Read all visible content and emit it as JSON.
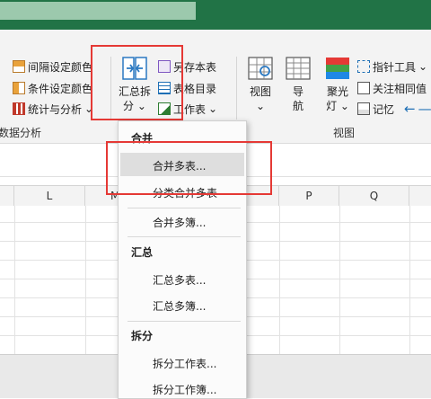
{
  "titlebar": {
    "color": "#217346"
  },
  "ribbon": {
    "left_items": [
      {
        "label": "间隔设定颜色",
        "icon": "interval-color-icon"
      },
      {
        "label": "条件设定颜色",
        "icon": "condition-color-icon"
      },
      {
        "label": "统计与分析",
        "icon": "statistics-icon",
        "arrow": "⌄"
      }
    ],
    "left_group_label": "数据分析",
    "merge_split": {
      "line1": "汇总拆",
      "line2": "分",
      "arrow": "⌄"
    },
    "mid_items": [
      {
        "label": "另存本表",
        "icon": "save-sheet-icon"
      },
      {
        "label": "表格目录",
        "icon": "sheet-catalog-icon"
      },
      {
        "label": "工作表",
        "icon": "worksheet-icon",
        "arrow": "⌄"
      }
    ],
    "view_buttons": [
      {
        "line1": "视图",
        "line2": "⌄"
      },
      {
        "line1": "导",
        "line2": "航"
      },
      {
        "line1": "聚光",
        "line2": "灯 ⌄"
      }
    ],
    "right_items": [
      {
        "label": "指针工具",
        "arrow": "⌄"
      },
      {
        "label": "关注相同值"
      },
      {
        "label": "记忆"
      }
    ],
    "view_group_label": "视图"
  },
  "columns": [
    "L",
    "M",
    "P",
    "Q"
  ],
  "menu": {
    "sections": [
      {
        "header": "合并",
        "items": [
          "合并多表...",
          "分类合并多表",
          "合并多簿..."
        ]
      },
      {
        "header": "汇总",
        "items": [
          "汇总多表...",
          "汇总多簿..."
        ]
      },
      {
        "header": "拆分",
        "items": [
          "拆分工作表...",
          "拆分工作簿..."
        ]
      }
    ],
    "highlighted": "合并多表..."
  },
  "colors": {
    "accent": "#217346",
    "highlight_box": "#e53935",
    "menu_hover": "#dedede"
  }
}
